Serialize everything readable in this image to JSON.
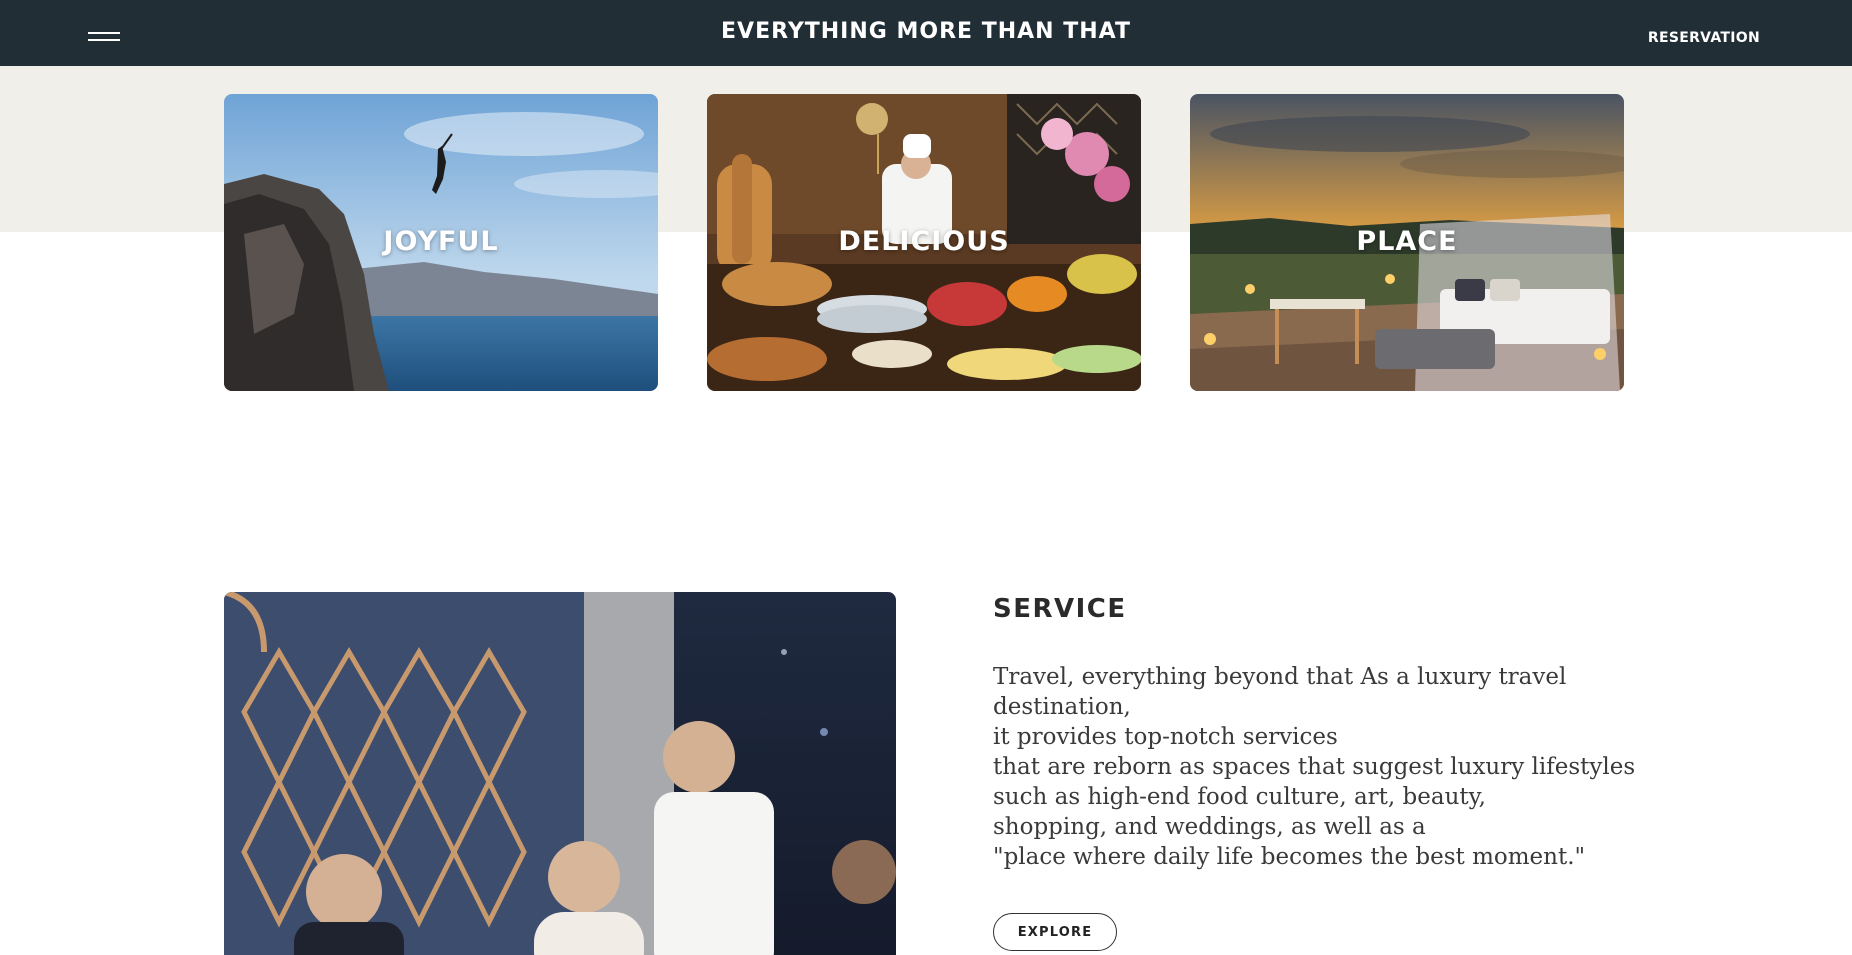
{
  "header": {
    "title": "EVERYTHING MORE THAN THAT",
    "reservation_label": "RESERVATION",
    "menu_icon": "hamburger-menu-icon",
    "background_color": "#212e35"
  },
  "cards": [
    {
      "label": "JOYFUL"
    },
    {
      "label": "DELICIOUS"
    },
    {
      "label": "PLACE"
    }
  ],
  "service": {
    "title": "SERVICE",
    "lines": [
      "Travel, everything beyond that As a luxury travel",
      "destination,",
      "it provides top-notch services",
      "that are reborn as spaces that suggest luxury lifestyles",
      "such as high-end food culture, art, beauty,",
      "shopping, and weddings, as well as a",
      "\"place where daily life becomes the best moment.\""
    ],
    "explore_label": "EXPLORE"
  },
  "colors": {
    "band": "#f1efea",
    "text_dark": "#2b2b2b"
  }
}
